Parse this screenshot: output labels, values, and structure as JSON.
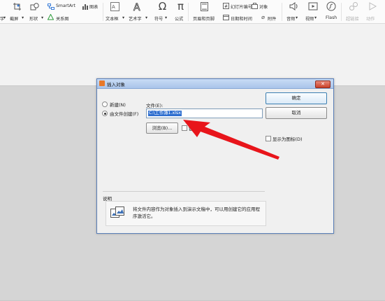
{
  "ribbon": {
    "row1": [
      {
        "icon": "smartart-icon",
        "label": "SmartArt"
      },
      {
        "icon": "chart-icon",
        "label": "图表"
      },
      {
        "icon": "slide-number-icon",
        "label": "幻灯片编号"
      },
      {
        "icon": "object-icon",
        "label": "对象"
      }
    ],
    "row2": [
      {
        "icon": "crop-icon",
        "label": "截屏"
      },
      {
        "icon": "shape-icon",
        "label": "形状"
      },
      {
        "icon": "relation-chart-icon",
        "label": "关系图"
      },
      {
        "icon": "datetime-icon",
        "label": "日期和时间"
      },
      {
        "icon": "attachment-icon",
        "label": "附件"
      }
    ],
    "large": [
      {
        "icon": "textbox-icon",
        "label": "文本框"
      },
      {
        "icon": "wordart-icon",
        "label": "艺术字"
      },
      {
        "icon": "symbol-icon",
        "label": "符号"
      },
      {
        "icon": "formula-icon",
        "label": "公式"
      },
      {
        "icon": "header-footer-icon",
        "label": "页眉和页脚"
      },
      {
        "icon": "audio-icon",
        "label": "音频"
      },
      {
        "icon": "video-icon",
        "label": "视频"
      },
      {
        "icon": "flash-icon",
        "label": "Flash"
      },
      {
        "icon": "hyperlink-icon",
        "label": "超链接"
      },
      {
        "icon": "action-icon",
        "label": "动作"
      }
    ],
    "left_fragment": "字"
  },
  "dialog": {
    "title": "插入对象",
    "option_new": "新建(N)",
    "option_from_file": "由文件创建(F)",
    "file_label": "文件(E):",
    "file_value": "C:\\工作簿1.xlsx",
    "browse_button": "浏览(B)...",
    "link_checkbox": "链",
    "ok_button": "确定",
    "cancel_button": "取消",
    "display_as_icon": "显示为图标(D)",
    "description_title": "说明",
    "description_text": "将文件内容作为对象插入到演示文稿中，可以用创建它的应用程序激活它。"
  },
  "colors": {
    "selection": "#2f6fd0",
    "arrow": "#e8151b",
    "titlebar": "#b6cdee"
  }
}
